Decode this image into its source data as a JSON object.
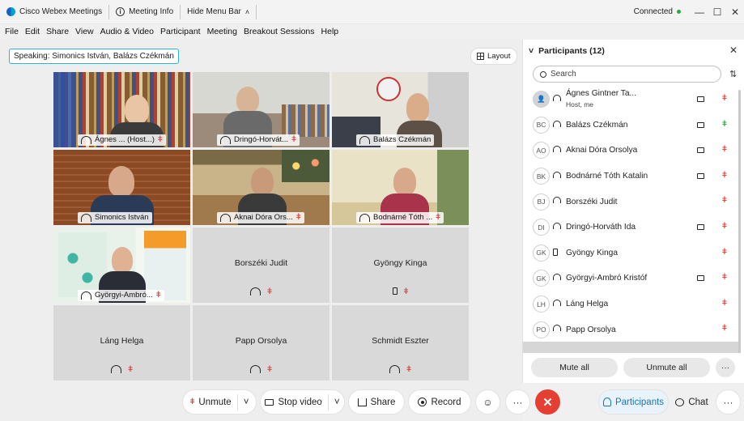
{
  "titlebar": {
    "app_title": "Cisco Webex Meetings",
    "meeting_info": "Meeting Info",
    "hide_menu": "Hide Menu Bar",
    "status": "Connected"
  },
  "menu": [
    "File",
    "Edit",
    "Share",
    "View",
    "Audio & Video",
    "Participant",
    "Meeting",
    "Breakout Sessions",
    "Help"
  ],
  "stage": {
    "speaking_label": "Speaking:",
    "speaking_names": "Simonics István, Balázs Czékmán",
    "layout_label": "Layout",
    "tiles": [
      {
        "name": "Ágnes ... (Host...)",
        "type": "video",
        "active": false
      },
      {
        "name": "Dringó-Horvát...",
        "type": "video",
        "active": false
      },
      {
        "name": "Balázs Czékmán",
        "type": "video",
        "active": true
      },
      {
        "name": "Simonics István",
        "type": "video",
        "active": true
      },
      {
        "name": "Aknai Dóra Ors...",
        "type": "video",
        "active": false
      },
      {
        "name": "Bodnárné Tóth ...",
        "type": "video",
        "active": false
      },
      {
        "name": "Györgyi-Ambró...",
        "type": "video",
        "active": false
      },
      {
        "name": "Borszéki Judit",
        "type": "audio",
        "device": "computer"
      },
      {
        "name": "Gyöngy Kinga",
        "type": "audio",
        "device": "phone"
      },
      {
        "name": "Láng Helga",
        "type": "audio",
        "device": "computer"
      },
      {
        "name": "Papp Orsolya",
        "type": "audio",
        "device": "computer"
      },
      {
        "name": "Schmidt Eszter",
        "type": "audio",
        "device": "computer"
      }
    ]
  },
  "toolbar": {
    "unmute": "Unmute",
    "stop_video": "Stop video",
    "share": "Share",
    "record": "Record",
    "participants": "Participants",
    "chat": "Chat"
  },
  "panel": {
    "title": "Participants (12)",
    "search_placeholder": "Search",
    "mute_all": "Mute all",
    "unmute_all": "Unmute all",
    "participants": [
      {
        "initials": "",
        "name": "Ágnes Gintner Ta...",
        "sub": "Host, me",
        "audio": "computer",
        "video": true,
        "mic": "muted",
        "host": true
      },
      {
        "initials": "BC",
        "name": "Balázs Czékmán",
        "sub": "",
        "audio": "computer",
        "video": true,
        "mic": "on",
        "host": false
      },
      {
        "initials": "AO",
        "name": "Aknai Dóra Orsolya",
        "sub": "",
        "audio": "computer",
        "video": true,
        "mic": "muted",
        "host": false
      },
      {
        "initials": "BK",
        "name": "Bodnárné Tóth Katalin",
        "sub": "",
        "audio": "computer",
        "video": true,
        "mic": "muted",
        "host": false
      },
      {
        "initials": "BJ",
        "name": "Borszéki Judit",
        "sub": "",
        "audio": "computer",
        "video": false,
        "mic": "muted",
        "host": false
      },
      {
        "initials": "DI",
        "name": "Dringó-Horváth Ida",
        "sub": "",
        "audio": "computer",
        "video": true,
        "mic": "muted",
        "host": false
      },
      {
        "initials": "GK",
        "name": "Gyöngy Kinga",
        "sub": "",
        "audio": "phone",
        "video": false,
        "mic": "muted",
        "host": false
      },
      {
        "initials": "GK",
        "name": "Györgyi-Ambró Kristóf",
        "sub": "",
        "audio": "computer",
        "video": true,
        "mic": "muted",
        "host": false
      },
      {
        "initials": "LH",
        "name": "Láng Helga",
        "sub": "",
        "audio": "computer",
        "video": false,
        "mic": "muted",
        "host": false
      },
      {
        "initials": "PO",
        "name": "Papp Orsolya",
        "sub": "",
        "audio": "computer",
        "video": false,
        "mic": "muted",
        "host": false
      }
    ]
  },
  "colors": {
    "accent": "#15b3e6",
    "end_call": "#e43f32",
    "muted": "#e0443e",
    "connected": "#2aa846"
  }
}
